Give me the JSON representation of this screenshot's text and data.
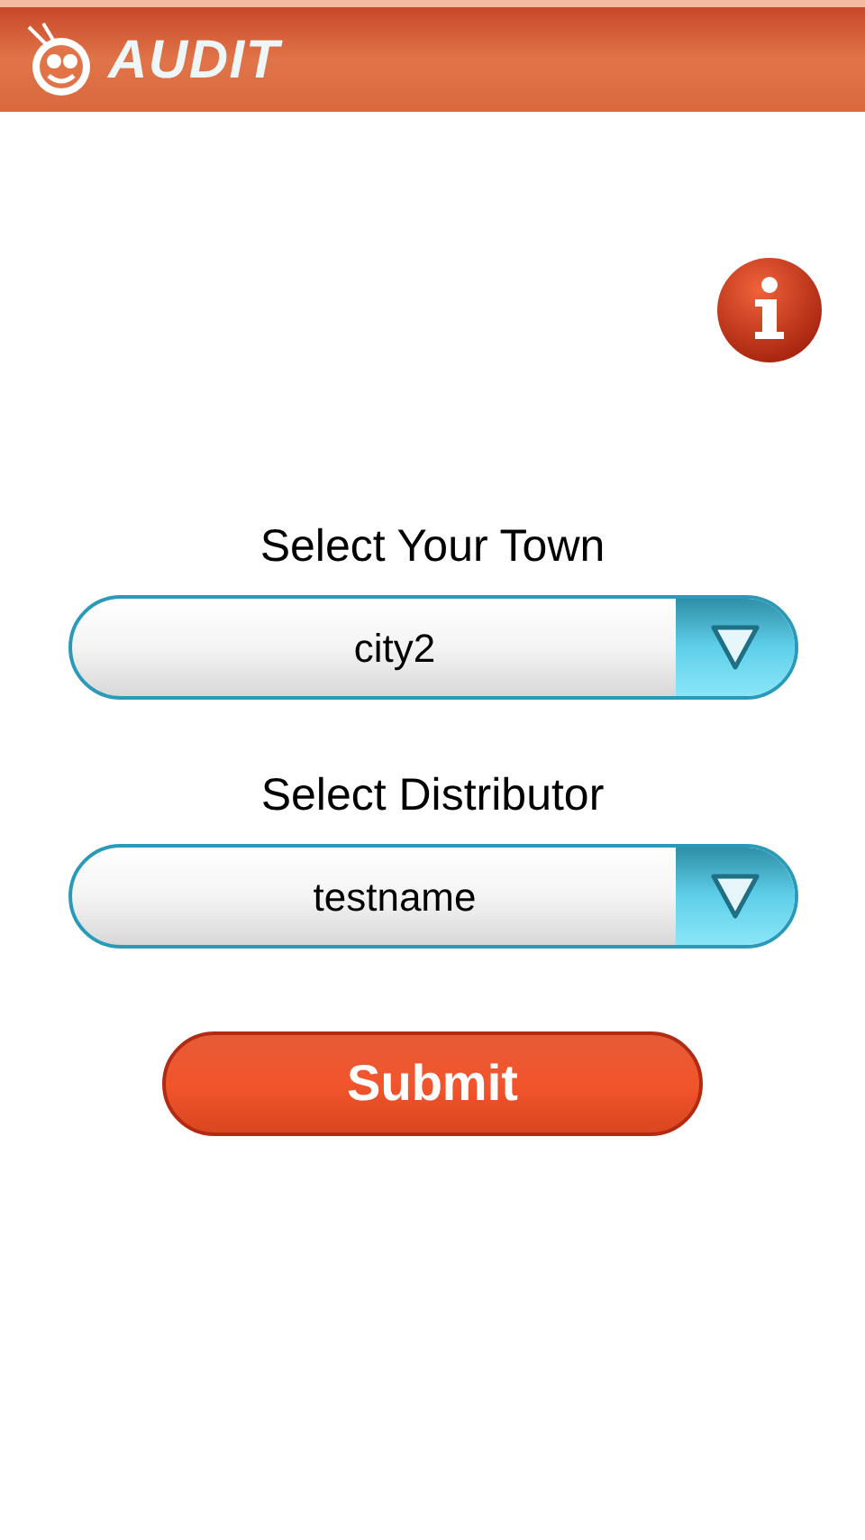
{
  "header": {
    "logo_text": "AUDIT"
  },
  "fields": [
    {
      "label": "Select Your Town",
      "value": "city2"
    },
    {
      "label": "Select Distributor",
      "value": "testname"
    }
  ],
  "submit_button": "Submit"
}
